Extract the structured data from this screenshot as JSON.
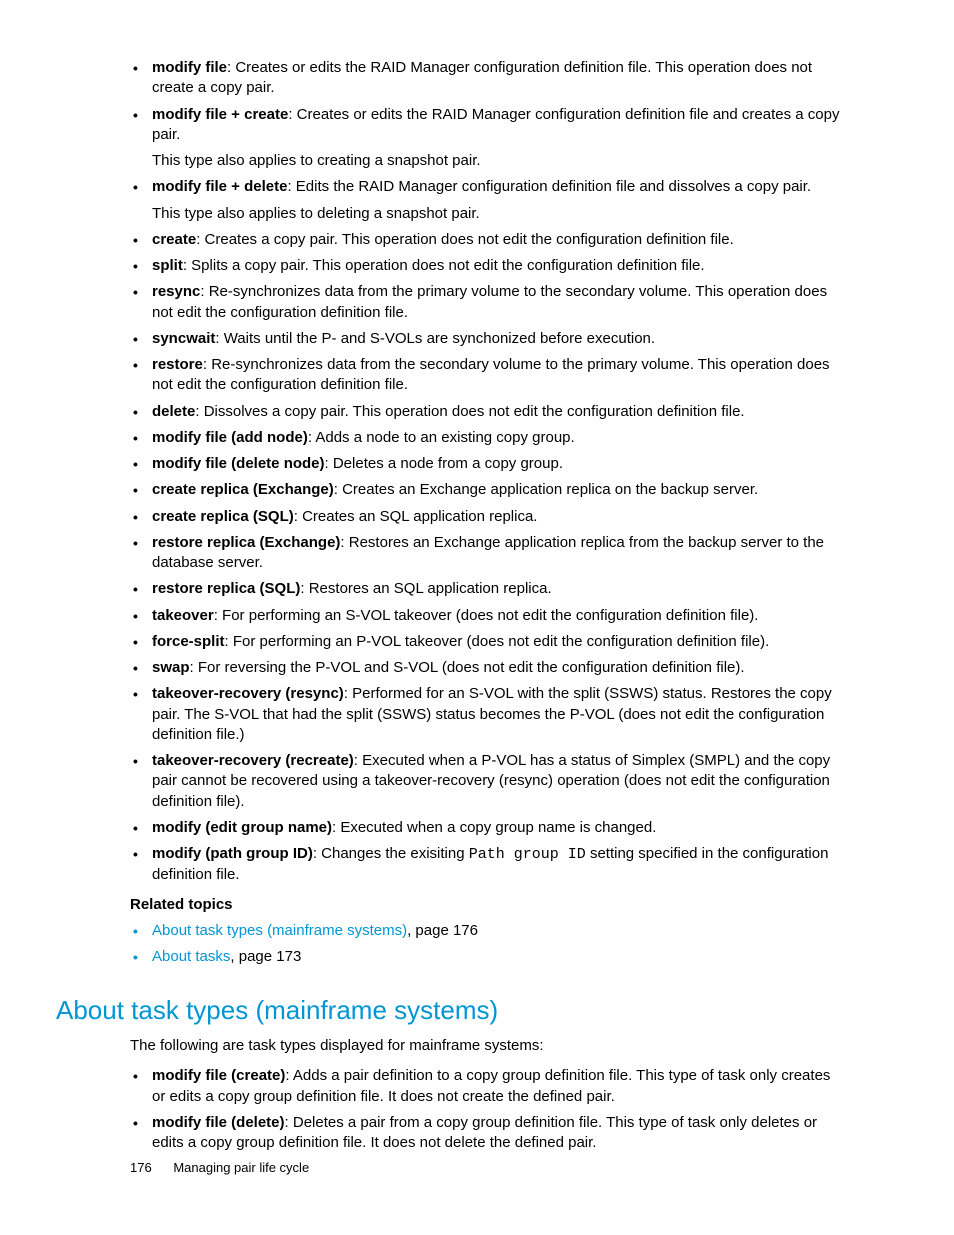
{
  "items": [
    {
      "term": "modify file",
      "desc": ": Creates or edits the RAID Manager configuration definition file. This operation does not create a copy pair."
    },
    {
      "term": "modify file + create",
      "desc": ": Creates or edits the RAID Manager configuration definition file and creates a copy pair.",
      "extra": "This type also applies to creating a snapshot pair."
    },
    {
      "term": "modify file + delete",
      "desc": ": Edits the RAID Manager configuration definition file and dissolves a copy pair.",
      "extra": "This type also applies to deleting a snapshot pair."
    },
    {
      "term": "create",
      "desc": ": Creates a copy pair. This operation does not edit the configuration definition file."
    },
    {
      "term": "split",
      "desc": ": Splits a copy pair.  This operation does not edit the configuration definition file."
    },
    {
      "term": "resync",
      "desc": ": Re-synchronizes data from the primary volume to the secondary volume.  This operation does not edit the configuration definition file."
    },
    {
      "term": "syncwait",
      "desc": ": Waits until the P- and S-VOLs are synchonized before execution."
    },
    {
      "term": "restore",
      "desc": ": Re-synchronizes data from the secondary volume to the primary volume.  This operation does not edit the configuration definition file."
    },
    {
      "term": "delete",
      "desc": ": Dissolves a copy pair. This operation does not edit the configuration definition file."
    },
    {
      "term": "modify file (add node)",
      "desc": ": Adds a node to an existing copy group."
    },
    {
      "term": "modify file (delete node)",
      "desc": ": Deletes a node from a copy group."
    },
    {
      "term": "create replica (Exchange)",
      "desc": ": Creates an Exchange application replica on the backup server."
    },
    {
      "term": "create replica (SQL)",
      "desc": ": Creates an SQL application replica."
    },
    {
      "term": "restore replica (Exchange)",
      "desc": ": Restores an Exchange application replica from the backup server to the database server."
    },
    {
      "term": "restore replica (SQL)",
      "desc": ": Restores an SQL application replica."
    },
    {
      "term": "takeover",
      "desc": ": For performing an S-VOL takeover (does not edit the configuration definition file)."
    },
    {
      "term": "force-split",
      "desc": ": For performing an P-VOL takeover (does not edit the configuration definition file)."
    },
    {
      "term": "swap",
      "desc": ": For reversing the P-VOL and S-VOL (does not edit the configuration definition file)."
    },
    {
      "term": "takeover-recovery (resync)",
      "desc": ": Performed for an S-VOL with the split (SSWS) status. Restores the copy pair. The S-VOL that had the split (SSWS) status becomes the P-VOL (does not edit the configuration definition file.)"
    },
    {
      "term": "takeover-recovery (recreate)",
      "desc": ": Executed when a P-VOL has a status of Simplex (SMPL) and the copy pair cannot be recovered using a takeover-recovery (resync) operation (does not edit the configuration definition file)."
    },
    {
      "term": "modify (edit group name)",
      "desc": ": Executed when a copy group name is changed."
    }
  ],
  "pathGroup": {
    "term": "modify (path group ID)",
    "pre": ": Changes the exisiting ",
    "code": "Path group ID",
    "post": " setting specified in the configuration definition file."
  },
  "related": {
    "heading": "Related topics",
    "links": [
      {
        "text": "About task types (mainframe systems)",
        "suffix": ", page 176"
      },
      {
        "text": "About tasks",
        "suffix": ", page 173"
      }
    ]
  },
  "section2": {
    "title": "About task types (mainframe systems)",
    "intro": "The following are task types displayed for mainframe systems:",
    "items": [
      {
        "term": "modify file (create)",
        "desc": ": Adds a pair definition to a copy group definition file. This type of task only creates or edits a copy group definition file. It does not create the defined pair."
      },
      {
        "term": "modify file (delete)",
        "desc": ": Deletes a pair from a copy group definition file. This type of task only deletes or edits a copy group definition file. It does not delete the defined pair."
      }
    ]
  },
  "footer": {
    "page": "176",
    "title": "Managing pair life cycle"
  }
}
